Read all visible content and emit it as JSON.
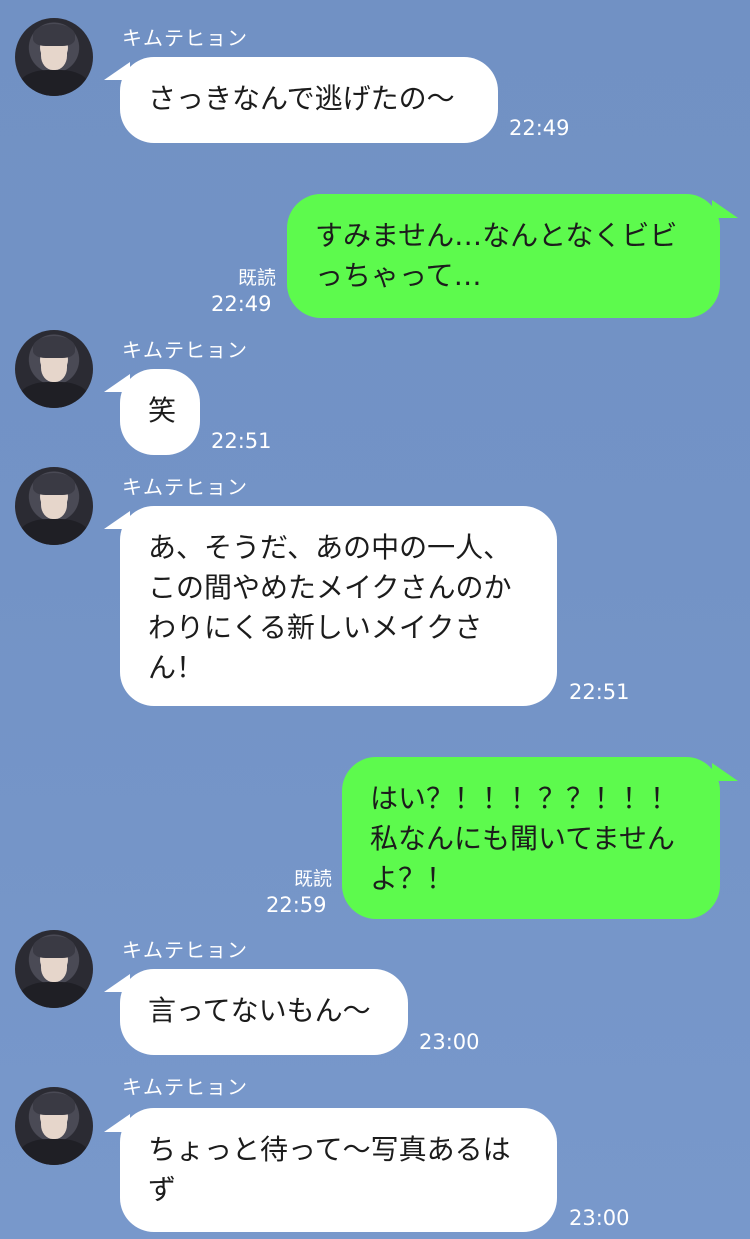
{
  "contact_name": "キムテヒョン",
  "read_label": "既読",
  "messages": [
    {
      "from": "them",
      "sender": "キムテヒョン",
      "text": "さっきなんで逃げたの〜",
      "time": "22:49"
    },
    {
      "from": "me",
      "text": "すみません…なんとなくビビっちゃって…",
      "read": "既読",
      "time": "22:49"
    },
    {
      "from": "them",
      "sender": "キムテヒョン",
      "text": "笑",
      "time": "22:51"
    },
    {
      "from": "them",
      "sender": "キムテヒョン",
      "text": "あ、そうだ、あの中の一人、この間やめたメイクさんのかわりにくる新しいメイクさん！",
      "time": "22:51"
    },
    {
      "from": "me",
      "text": "はい？！！！？？！！！私なんにも聞いてませんよ？！",
      "read": "既読",
      "time": "22:59"
    },
    {
      "from": "them",
      "sender": "キムテヒョン",
      "text": "言ってないもん〜",
      "time": "23:00"
    },
    {
      "from": "them",
      "sender": "キムテヒョン",
      "text": "ちょっと待って〜写真あるはず",
      "time": "23:00"
    }
  ],
  "colors": {
    "background": "#7393c6",
    "bubble_in": "#ffffff",
    "bubble_out": "#5dfa4d"
  }
}
